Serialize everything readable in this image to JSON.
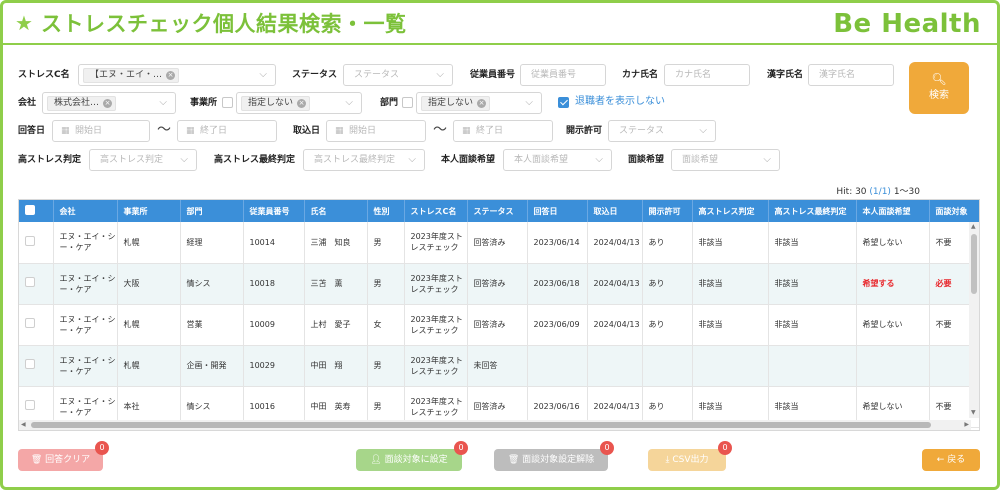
{
  "header": {
    "title": "ストレスチェック個人結果検索・一覧",
    "logo": "Be Health"
  },
  "filters": {
    "stress_c": {
      "label": "ストレスC名",
      "tag": "【エヌ・エイ・…"
    },
    "status": {
      "label": "ステータス",
      "placeholder": "ステータス"
    },
    "employee_no": {
      "label": "従業員番号",
      "placeholder": "従業員番号"
    },
    "kana_name": {
      "label": "カナ氏名",
      "placeholder": "カナ氏名"
    },
    "kanji_name": {
      "label": "漢字氏名",
      "placeholder": "漢字氏名"
    },
    "company": {
      "label": "会社",
      "tag": "株式会社…"
    },
    "office": {
      "label": "事業所",
      "tag": "指定しない"
    },
    "dept": {
      "label": "部門",
      "tag": "指定しない"
    },
    "retired": {
      "label": "退職者を表示しない",
      "checked": true
    },
    "answer_date": {
      "label": "回答日",
      "start_placeholder": "開始日",
      "end_placeholder": "終了日"
    },
    "import_date": {
      "label": "取込日",
      "start_placeholder": "開始日",
      "end_placeholder": "終了日"
    },
    "disclosure": {
      "label": "開示許可",
      "placeholder": "ステータス"
    },
    "high_stress": {
      "label": "高ストレス判定",
      "placeholder": "高ストレス判定"
    },
    "high_stress_final": {
      "label": "高ストレス最終判定",
      "placeholder": "高ストレス最終判定"
    },
    "self_interview": {
      "label": "本人面談希望",
      "placeholder": "本人面談希望"
    },
    "interview": {
      "label": "面談希望",
      "placeholder": "面談希望"
    },
    "tilde": "〜"
  },
  "search_button": {
    "label": "検索"
  },
  "hits": {
    "prefix": "Hit: 30",
    "page": "(1/1)",
    "range": "1〜30"
  },
  "table": {
    "columns": [
      "会社",
      "事業所",
      "部門",
      "従業員番号",
      "氏名",
      "性別",
      "ストレスC名",
      "ステータス",
      "回答日",
      "取込日",
      "開示許可",
      "高ストレス判定",
      "高ストレス最終判定",
      "本人面談希望",
      "面談対象"
    ],
    "rows": [
      {
        "company": "エヌ・エイ・シー・ケア",
        "office": "札幌",
        "dept": "経理",
        "no": "10014",
        "name": "三浦　知良",
        "sex": "男",
        "stress_c": "2023年度ストレスチェック",
        "status": "回答済み",
        "answer": "2023/06/14",
        "import": "2024/04/13",
        "disclose": "あり",
        "hs": "非該当",
        "hs_final": "非該当",
        "self_iv": "希望しない",
        "target": "不要"
      },
      {
        "company": "エヌ・エイ・シー・ケア",
        "office": "大阪",
        "dept": "情シス",
        "no": "10018",
        "name": "三苫　薫",
        "sex": "男",
        "stress_c": "2023年度ストレスチェック",
        "status": "回答済み",
        "answer": "2023/06/18",
        "import": "2024/04/13",
        "disclose": "あり",
        "hs": "非該当",
        "hs_final": "非該当",
        "self_iv": "希望する",
        "target": "必要"
      },
      {
        "company": "エヌ・エイ・シー・ケア",
        "office": "札幌",
        "dept": "営業",
        "no": "10009",
        "name": "上村　愛子",
        "sex": "女",
        "stress_c": "2023年度ストレスチェック",
        "status": "回答済み",
        "answer": "2023/06/09",
        "import": "2024/04/13",
        "disclose": "あり",
        "hs": "非該当",
        "hs_final": "非該当",
        "self_iv": "希望しない",
        "target": "不要"
      },
      {
        "company": "エヌ・エイ・シー・ケア",
        "office": "札幌",
        "dept": "企画・開発",
        "no": "10029",
        "name": "中田　翔",
        "sex": "男",
        "stress_c": "2023年度ストレスチェック",
        "status": "未回答",
        "answer": "",
        "import": "",
        "disclose": "",
        "hs": "",
        "hs_final": "",
        "self_iv": "",
        "target": ""
      },
      {
        "company": "エヌ・エイ・シー・ケア",
        "office": "本社",
        "dept": "情シス",
        "no": "10016",
        "name": "中田　英寿",
        "sex": "男",
        "stress_c": "2023年度ストレスチェック",
        "status": "回答済み",
        "answer": "2023/06/16",
        "import": "2024/04/13",
        "disclose": "あり",
        "hs": "非該当",
        "hs_final": "非該当",
        "self_iv": "希望しない",
        "target": "不要"
      }
    ]
  },
  "footer": {
    "clear": {
      "label": "回答クリア",
      "count": "0",
      "color": "#f4a7a7"
    },
    "set_target": {
      "label": "面談対象に設定",
      "count": "0",
      "color": "#a7d68a"
    },
    "unset_target": {
      "label": "面談対象設定解除",
      "count": "0",
      "color": "#bdbdbd"
    },
    "csv": {
      "label": "CSV出力",
      "count": "0",
      "color": "#f5d59a"
    },
    "back": {
      "label": "戻る",
      "color": "#f0a93a"
    }
  }
}
